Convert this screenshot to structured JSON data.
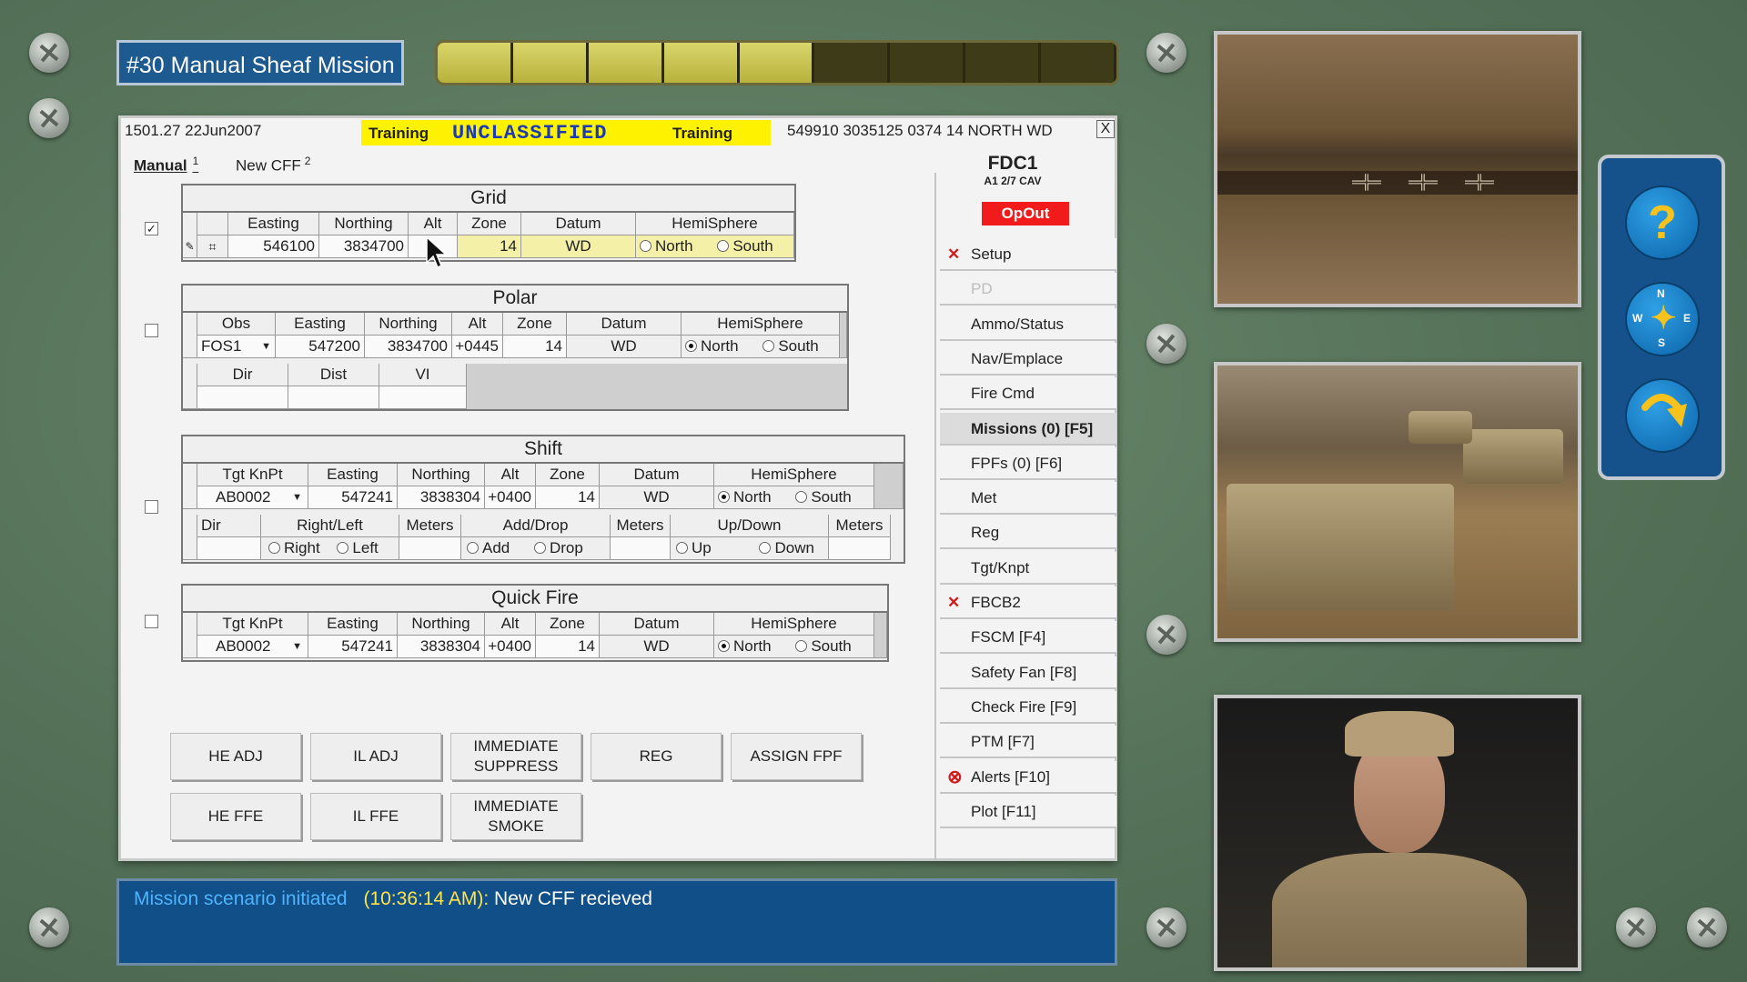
{
  "mission": {
    "title": "#30 Manual Sheaf Mission"
  },
  "progress": {
    "filled_segments": 5,
    "total_segments": 9
  },
  "header": {
    "time_date": "1501.27 22Jun2007",
    "training_left": "Training",
    "classification": "UNCLASSIFIED",
    "training_right": "Training",
    "coords": "549910 3035125 0374 14 NORTH WD",
    "close": "X"
  },
  "tabs": [
    {
      "label": "Manual",
      "num": "1"
    },
    {
      "label": "New CFF",
      "num": "2"
    }
  ],
  "grid": {
    "title": "Grid",
    "checked": true,
    "headers": [
      "Easting",
      "Northing",
      "Alt",
      "Zone",
      "Datum",
      "HemiSphere"
    ],
    "easting": "546100",
    "northing": "3834700",
    "alt": "",
    "zone": "14",
    "datum": "WD",
    "hemi_north": "North",
    "hemi_south": "South"
  },
  "polar": {
    "title": "Polar",
    "headers": [
      "Obs",
      "Easting",
      "Northing",
      "Alt",
      "Zone",
      "Datum",
      "HemiSphere"
    ],
    "obs": "FOS1",
    "easting": "547200",
    "northing": "3834700",
    "alt": "+0445",
    "zone": "14",
    "datum": "WD",
    "hemi_north": "North",
    "hemi_south": "South",
    "sub_headers": [
      "Dir",
      "Dist",
      "VI"
    ]
  },
  "shift": {
    "title": "Shift",
    "headers": [
      "Tgt KnPt",
      "Easting",
      "Northing",
      "Alt",
      "Zone",
      "Datum",
      "HemiSphere"
    ],
    "tgt": "AB0002",
    "easting": "547241",
    "northing": "3838304",
    "alt": "+0400",
    "zone": "14",
    "datum": "WD",
    "hemi_north": "North",
    "hemi_south": "South",
    "sub_headers": [
      "Dir",
      "Right/Left",
      "Meters",
      "Add/Drop",
      "Meters",
      "Up/Down",
      "Meters"
    ],
    "right": "Right",
    "left": "Left",
    "add": "Add",
    "drop": "Drop",
    "up": "Up",
    "down": "Down"
  },
  "quickfire": {
    "title": "Quick Fire",
    "headers": [
      "Tgt KnPt",
      "Easting",
      "Northing",
      "Alt",
      "Zone",
      "Datum",
      "HemiSphere"
    ],
    "tgt": "AB0002",
    "easting": "547241",
    "northing": "3838304",
    "alt": "+0400",
    "zone": "14",
    "datum": "WD",
    "hemi_north": "North",
    "hemi_south": "South"
  },
  "buttons": {
    "he_adj": "HE   ADJ",
    "il_adj": "IL   ADJ",
    "imm_suppress_1": "IMMEDIATE",
    "imm_suppress_2": "SUPPRESS",
    "reg": "REG",
    "assign_fpf": "ASSIGN  FPF",
    "he_ffe": "HE   FFE",
    "il_ffe": "IL   FFE",
    "imm_smoke_1": "IMMEDIATE",
    "imm_smoke_2": "SMOKE"
  },
  "fdc": {
    "title": "FDC1",
    "subtitle": "A1 2/7 CAV",
    "opout": "OpOut"
  },
  "menu": [
    {
      "label": "Setup",
      "mark": "x"
    },
    {
      "label": "PD",
      "mark": ""
    },
    {
      "label": "Ammo/Status",
      "mark": ""
    },
    {
      "label": "Nav/Emplace",
      "mark": ""
    },
    {
      "label": "Fire Cmd",
      "mark": ""
    },
    {
      "label": "Missions (0) [F5]",
      "mark": ""
    },
    {
      "label": "FPFs (0)   [F6]",
      "mark": ""
    },
    {
      "label": "Met",
      "mark": ""
    },
    {
      "label": "Reg",
      "mark": ""
    },
    {
      "label": "Tgt/Knpt",
      "mark": ""
    },
    {
      "label": "FBCB2",
      "mark": "x"
    },
    {
      "label": "FSCM [F4]",
      "mark": ""
    },
    {
      "label": "Safety Fan [F8]",
      "mark": ""
    },
    {
      "label": "Check Fire [F9]",
      "mark": ""
    },
    {
      "label": "PTM [F7]",
      "mark": ""
    },
    {
      "label": "Alerts [F10]",
      "mark": "circle-x"
    },
    {
      "label": "Plot [F11]",
      "mark": ""
    }
  ],
  "status": {
    "scenario": "Mission scenario initiated",
    "time": "(10:36:14 AM):",
    "message": "New CFF recieved"
  },
  "side_nav": {
    "help": "?",
    "compass_n": "N",
    "compass_s": "S",
    "compass_w": "W",
    "compass_e": "E"
  },
  "colors": {
    "status_bg": "#104f88",
    "opout": "#f21b1b",
    "classification": "#fff200"
  }
}
